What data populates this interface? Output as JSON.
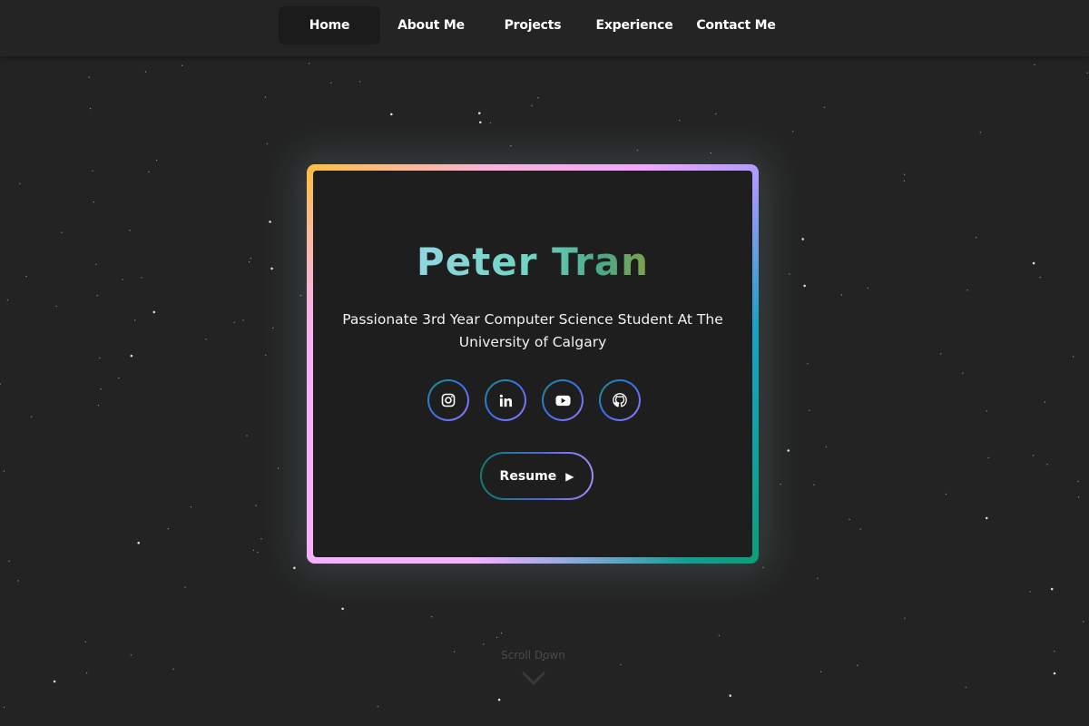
{
  "nav": {
    "items": [
      {
        "label": "Home",
        "active": true
      },
      {
        "label": "About Me",
        "active": false
      },
      {
        "label": "Projects",
        "active": false
      },
      {
        "label": "Experience",
        "active": false
      },
      {
        "label": "Contact Me",
        "active": false
      }
    ]
  },
  "hero": {
    "name": "Peter Tran",
    "tagline": "Passionate 3rd Year Computer Science Student At The University of Calgary",
    "socials": [
      {
        "icon": "instagram-icon"
      },
      {
        "icon": "linkedin-icon"
      },
      {
        "icon": "youtube-icon"
      },
      {
        "icon": "github-icon"
      }
    ],
    "resume_label": "Resume",
    "resume_arrow": "▶"
  },
  "scroll": {
    "label": "Scroll Down",
    "icon": "chevron-down-icon"
  },
  "colors": {
    "background": "#232323",
    "card": "#1e1e1e",
    "nav_active": "#1b1b1b"
  }
}
